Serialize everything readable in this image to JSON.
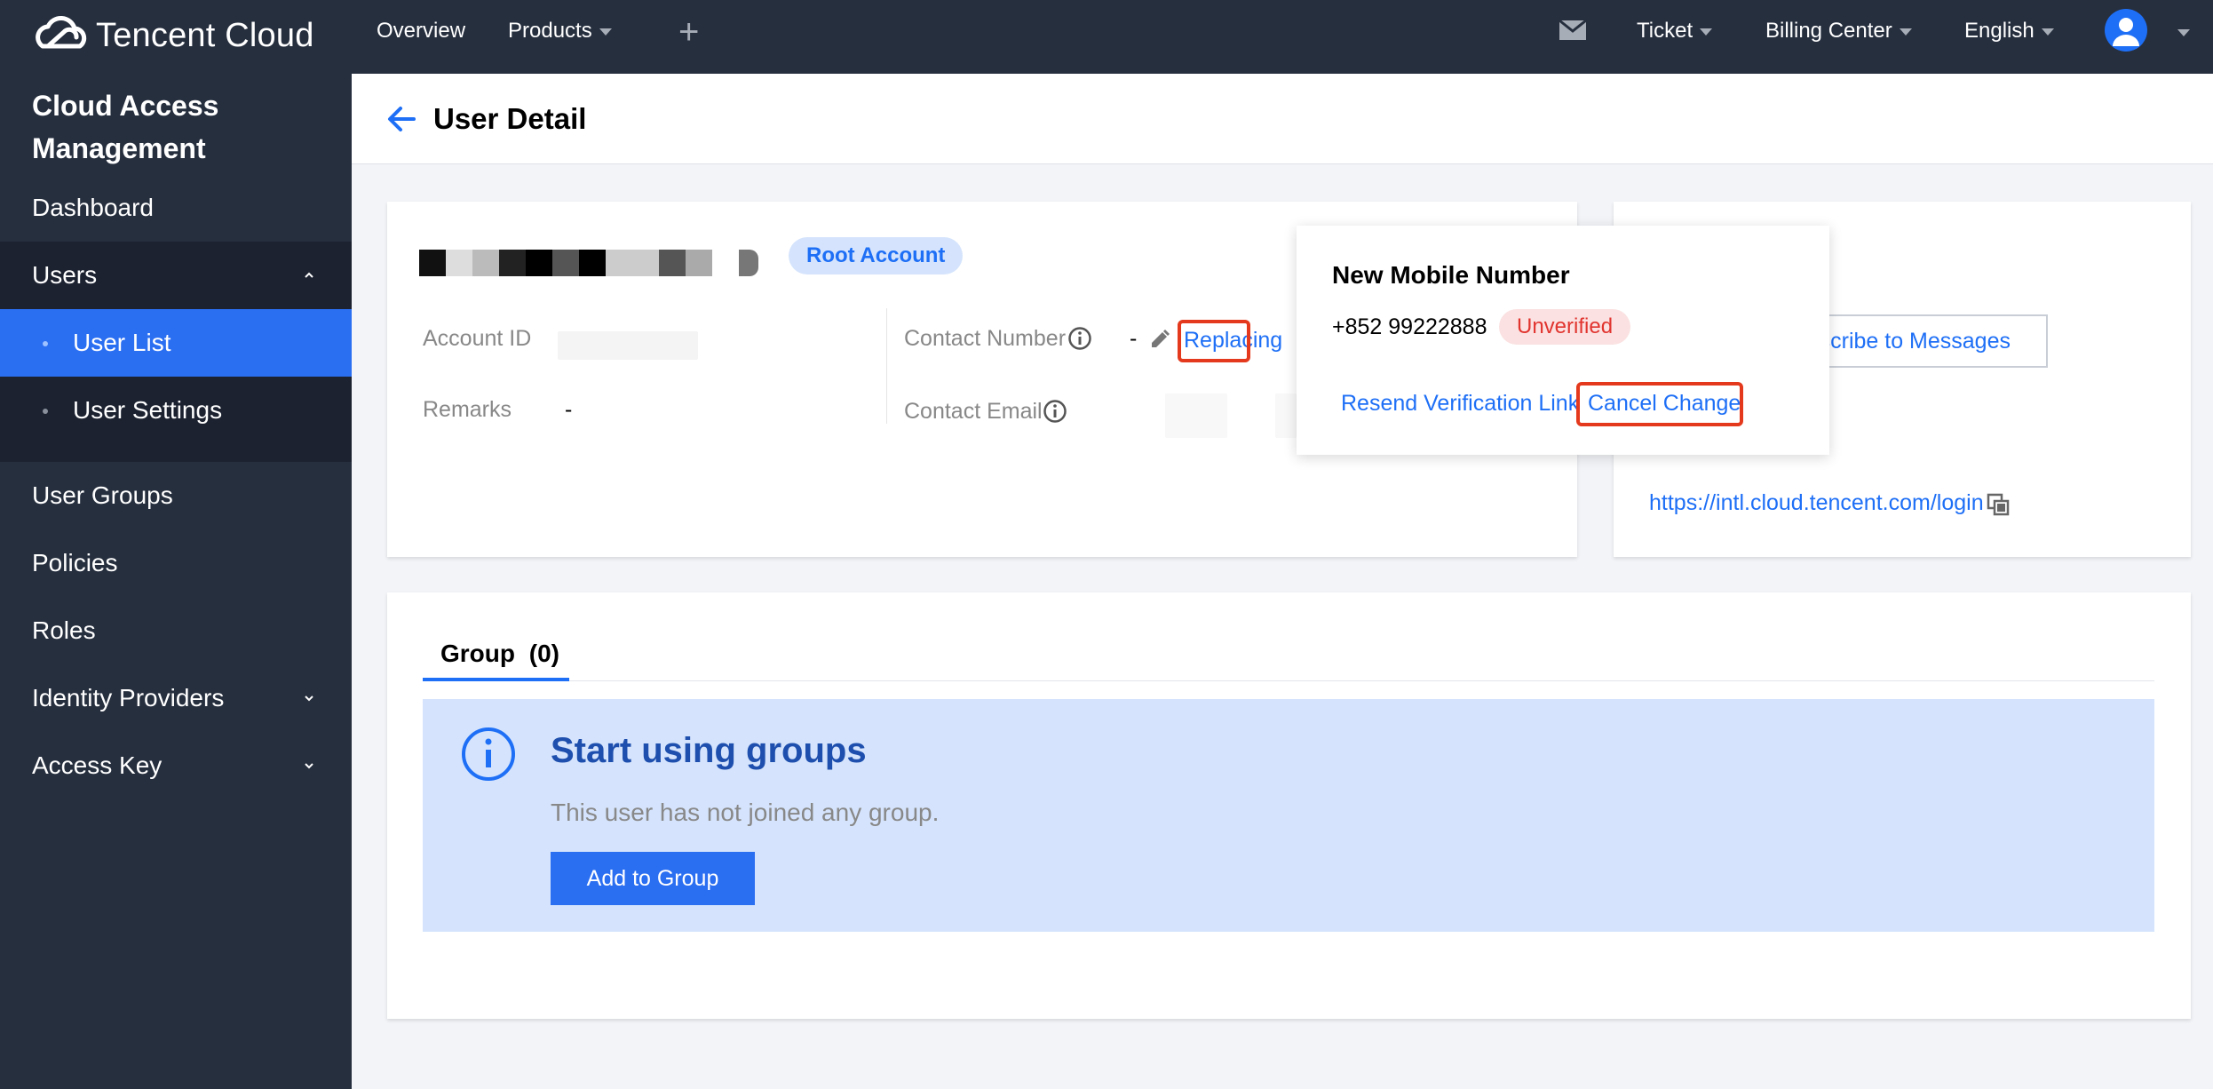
{
  "brand": {
    "name": "Tencent Cloud"
  },
  "topnav": {
    "overview": "Overview",
    "products": "Products",
    "plus": "+",
    "ticket": "Ticket",
    "billing": "Billing Center",
    "language": "English"
  },
  "sidebar": {
    "title_line1": "Cloud Access",
    "title_line2": "Management",
    "items": {
      "dashboard": "Dashboard",
      "users": "Users",
      "user_list": "User List",
      "user_settings": "User Settings",
      "user_groups": "User Groups",
      "policies": "Policies",
      "roles": "Roles",
      "identity_providers": "Identity Providers",
      "access_key": "Access Key"
    }
  },
  "header": {
    "title": "User Detail"
  },
  "user_card": {
    "badge": "Root Account",
    "account_id_label": "Account ID",
    "remarks_label": "Remarks",
    "remarks_value": "-",
    "contact_number_label": "Contact Number",
    "contact_number_value": "-",
    "replacing_link": "Replacing",
    "contact_email_label": "Contact Email"
  },
  "popover": {
    "title": "New Mobile Number",
    "number": "+852 99222888",
    "status": "Unverified",
    "resend_link": "Resend Verification Link",
    "cancel_link": "Cancel Change"
  },
  "right_card": {
    "subscribe_button": "Subscribe to Messages",
    "login_url": "https://intl.cloud.tencent.com/login"
  },
  "group_card": {
    "tab_label": "Group",
    "tab_count": "(0)",
    "empty_title": "Start using groups",
    "empty_desc": "This user has not joined any group.",
    "add_button": "Add to Group"
  },
  "colors": {
    "topbar": "#262f3e",
    "accent": "#1e6ff6",
    "highlight_box": "#e4391c",
    "unverified": "#e1342f"
  }
}
